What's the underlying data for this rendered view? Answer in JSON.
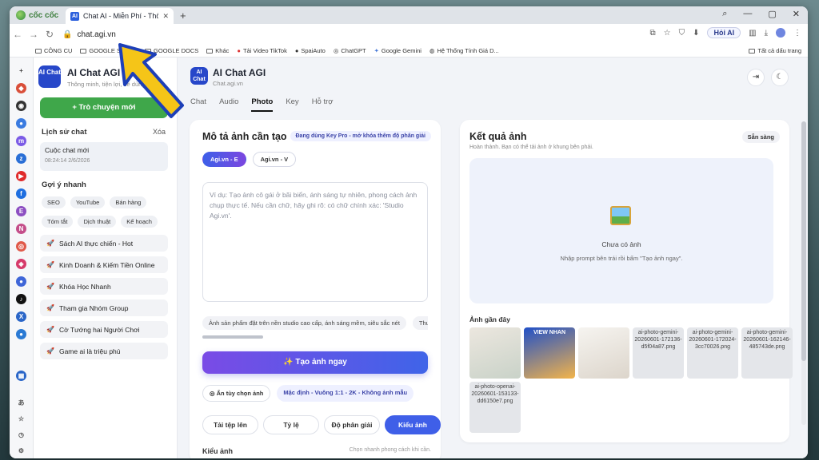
{
  "browser": {
    "brand": "cốc cốc",
    "tab_title": "Chat AI - Miễn Phí - Thông",
    "url": "chat.agi.vn",
    "hoi_ai": "Hỏi AI",
    "bookmarks": [
      "CÔNG CỤ",
      "GOOGLE SHEET",
      "GOOGLE DOCS",
      "Khác",
      "Tải Video TikTok",
      "SpaiAuto",
      "ChatGPT",
      "Google Gemini",
      "Hệ Thống Tính Giá D..."
    ],
    "all_bookmarks": "Tất cả dấu trang"
  },
  "sidebar": {
    "logo": "AI Chat",
    "title": "AI Chat AGI",
    "subtitle": "Thông minh, tiện lợi, dễ dùng",
    "new_chat": "+ Trò chuyện mới",
    "history_h": "Lịch sử chat",
    "delete": "Xóa",
    "chat_title": "Cuộc chat mới",
    "chat_time": "08:24:14 2/6/2026",
    "quick_h": "Gợi ý nhanh",
    "chips1": [
      "SEO",
      "YouTube",
      "Bán hàng"
    ],
    "chips2": [
      "Tóm tắt",
      "Dịch thuật",
      "Kế hoạch"
    ],
    "links": [
      "Sách AI thực chiến - Hot",
      "Kinh Doanh & Kiếm Tiền Online",
      "Khóa Học Nhanh",
      "Tham gia Nhóm Group",
      "Cờ Tướng hai Người Chơi",
      "Game ai là triệu phú"
    ]
  },
  "header": {
    "logo": "AI Chat",
    "title": "AI Chat AGI",
    "subtitle": "Chat.agi.vn",
    "tabs": [
      "Chat",
      "Audio",
      "Photo",
      "Key",
      "Hỗ trợ"
    ]
  },
  "left_card": {
    "title": "Mô tả ảnh cần tạo",
    "pro_badge": "Đang dùng Key Pro - mở khóa thêm độ phân giải",
    "models": [
      "Agi.vn - E",
      "Agi.vn - V"
    ],
    "placeholder": "Ví dụ: Tạo ảnh cô gái ở bãi biển, ánh sáng tự nhiên, phong cách ảnh chụp thực tế. Nếu cần chữ, hãy ghi rõ: có chữ chính xác: 'Studio Agi.vn'.",
    "suggestions": [
      "Ảnh sản phẩm đặt trên nền studio cao cấp, ánh sáng mềm, siêu sắc nét",
      "Thumbna"
    ],
    "generate": "✨ Tạo ảnh ngay",
    "hide_opts": "◎ Ẩn tùy chọn ảnh",
    "defaults": "Mặc định - Vuông 1:1 - 2K - Không ảnh mẫu",
    "segments": [
      "Tải tệp lên",
      "Tỷ lệ",
      "Độ phân giải",
      "Kiểu ảnh"
    ],
    "style_h": "Kiểu ảnh",
    "style_hint": "Chọn nhanh phong cách khi cần."
  },
  "right_card": {
    "title": "Kết quả ảnh",
    "status": "Sẵn sàng",
    "sub": "Hoàn thành. Bạn có thể tải ảnh ở khung bên phải.",
    "empty_t": "Chưa có ảnh",
    "empty_s": "Nhập prompt bên trái rồi bấm \"Tạo ảnh ngay\".",
    "recent_h": "Ảnh gần đây",
    "thumbs": [
      "",
      "VIEW NHAN",
      "",
      "ai-photo-gemini-20260601-172136-d5f04a87.png",
      "ai-photo-gemini-20260601-172024-3cc70026.png",
      "ai-photo-gemini-20260601-162146-485743de.png",
      "ai-photo-openai-20260601-153133-dd6150e7.png"
    ]
  }
}
